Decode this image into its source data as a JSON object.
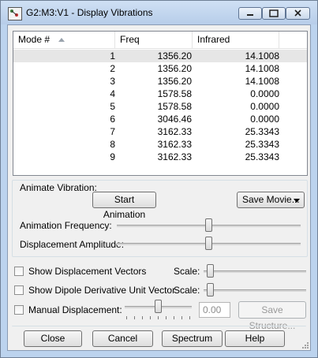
{
  "window": {
    "title": "G2:M3:V1 - Display Vibrations",
    "minimize_glyph": "▭",
    "maximize_glyph": "▭",
    "close_glyph": "✕"
  },
  "table": {
    "headers": {
      "mode": "Mode #",
      "freq": "Freq",
      "ir": "Infrared"
    },
    "rows": [
      {
        "mode": "1",
        "freq": "1356.20",
        "ir": "14.1008"
      },
      {
        "mode": "2",
        "freq": "1356.20",
        "ir": "14.1008"
      },
      {
        "mode": "3",
        "freq": "1356.20",
        "ir": "14.1008"
      },
      {
        "mode": "4",
        "freq": "1578.58",
        "ir": "0.0000"
      },
      {
        "mode": "5",
        "freq": "1578.58",
        "ir": "0.0000"
      },
      {
        "mode": "6",
        "freq": "3046.46",
        "ir": "0.0000"
      },
      {
        "mode": "7",
        "freq": "3162.33",
        "ir": "25.3343"
      },
      {
        "mode": "8",
        "freq": "3162.33",
        "ir": "25.3343"
      },
      {
        "mode": "9",
        "freq": "3162.33",
        "ir": "25.3343"
      }
    ],
    "selected_row": 0
  },
  "animate": {
    "label": "Animate Vibration:",
    "start_label": "Start Animation",
    "save_movie_label": "Save Movie...",
    "frequency_label": "Animation Frequency:",
    "frequency_level": 0.5,
    "amplitude_label": "Displacement Amplitude:",
    "amplitude_level": 0.5
  },
  "options": {
    "show_vectors_label": "Show Displacement Vectors",
    "show_vectors_checked": false,
    "show_dipole_label": "Show Dipole Derivative Unit Vector",
    "show_dipole_checked": false,
    "scale_label": "Scale:",
    "scale_level_1": 0.03,
    "scale_level_2": 0.03,
    "manual_label": "Manual Displacement:",
    "manual_checked": false,
    "manual_level": 0.5,
    "manual_value": "0.00",
    "save_structure_label": "Save Structure..."
  },
  "footer": {
    "close_label": "Close",
    "cancel_label": "Cancel",
    "spectrum_label": "Spectrum",
    "help_label": "Help"
  },
  "colors": {
    "frame": "#bcd3ee",
    "selected_row": "#e6e6e6"
  }
}
